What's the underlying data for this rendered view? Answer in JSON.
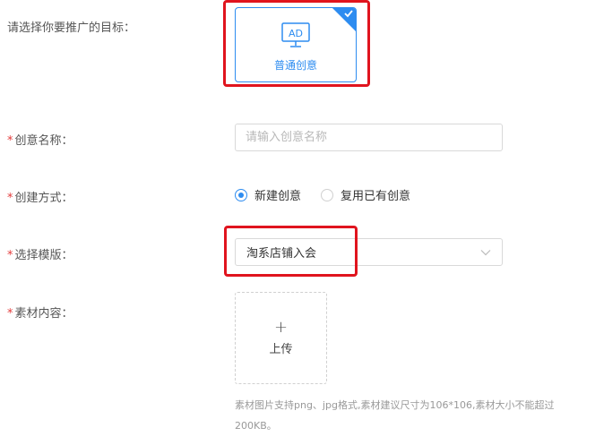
{
  "form": {
    "goal_label": "请选择你要推广的目标：",
    "goal_option": {
      "icon_text": "AD",
      "label": "普通创意",
      "selected": true
    },
    "name_label": "创意名称：",
    "name_placeholder": "请输入创意名称",
    "name_value": "",
    "method_label": "创建方式：",
    "method_options": [
      {
        "label": "新建创意",
        "checked": true
      },
      {
        "label": "复用已有创意",
        "checked": false
      }
    ],
    "template_label": "选择模版：",
    "template_value": "淘系店铺入会",
    "material_label": "素材内容：",
    "upload_plus": "+",
    "upload_label": "上传",
    "material_hint": "素材图片支持png、jpg格式,素材建议尺寸为106*106,素材大小不能超过200KB。",
    "required_mark": "*"
  },
  "colors": {
    "accent": "#2d8cf0",
    "required": "#e33a3a",
    "highlight": "#e0141e"
  }
}
